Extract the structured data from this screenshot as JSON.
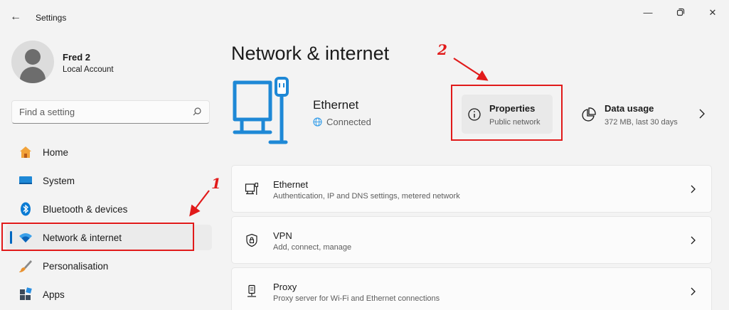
{
  "window": {
    "title": "Settings"
  },
  "profile": {
    "name": "Fred 2",
    "account_type": "Local Account"
  },
  "search": {
    "placeholder": "Find a setting"
  },
  "sidebar": {
    "items": [
      {
        "label": "Home",
        "icon": "home-icon"
      },
      {
        "label": "System",
        "icon": "system-icon"
      },
      {
        "label": "Bluetooth & devices",
        "icon": "bluetooth-icon"
      },
      {
        "label": "Network & internet",
        "icon": "wifi-icon",
        "active": true
      },
      {
        "label": "Personalisation",
        "icon": "brush-icon"
      },
      {
        "label": "Apps",
        "icon": "apps-icon"
      }
    ]
  },
  "main": {
    "title": "Network & internet",
    "hero": {
      "title": "Ethernet",
      "status": "Connected"
    },
    "properties": {
      "title": "Properties",
      "subtitle": "Public network"
    },
    "data_usage": {
      "title": "Data usage",
      "subtitle": "372 MB, last 30 days"
    },
    "rows": [
      {
        "title": "Ethernet",
        "subtitle": "Authentication, IP and DNS settings, metered network",
        "icon": "ethernet-icon"
      },
      {
        "title": "VPN",
        "subtitle": "Add, connect, manage",
        "icon": "vpn-shield-icon"
      },
      {
        "title": "Proxy",
        "subtitle": "Proxy server for Wi-Fi and Ethernet connections",
        "icon": "proxy-icon"
      }
    ]
  },
  "annotations": {
    "num1": "1",
    "num2": "2",
    "color": "#e11a1a"
  },
  "colors": {
    "accent": "#0067c0",
    "background": "#f3f3f3"
  }
}
